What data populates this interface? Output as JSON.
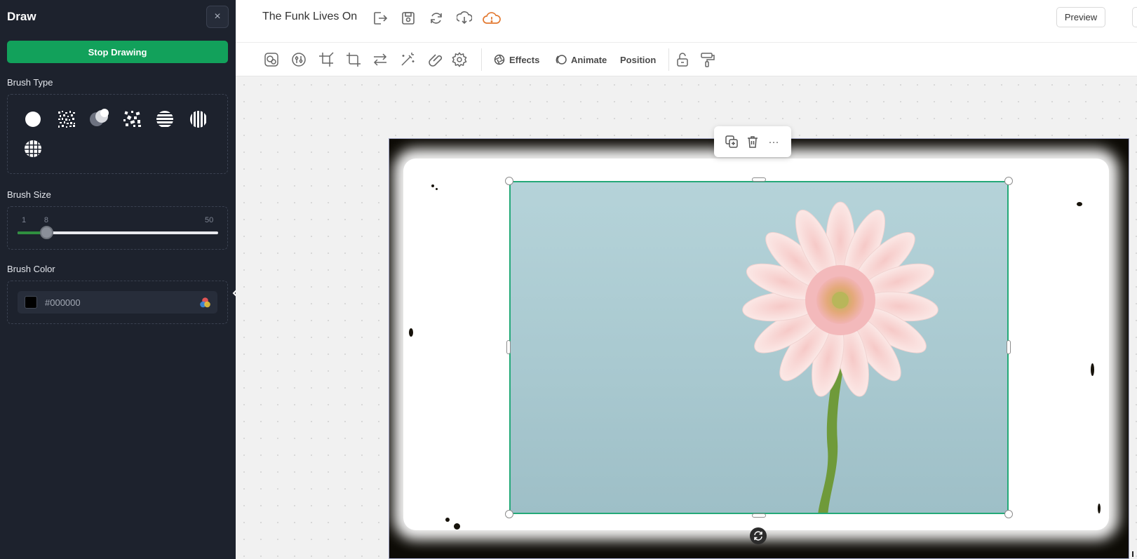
{
  "sidebar": {
    "title": "Draw",
    "close_glyph": "×",
    "stop_button": "Stop Drawing",
    "brush_type_label": "Brush Type",
    "brush_types": [
      "circle-brush-icon",
      "spray-brush-icon",
      "bubble-brush-icon",
      "splatter-brush-icon",
      "horizontal-lines-brush-icon",
      "vertical-lines-brush-icon",
      "grid-brush-icon"
    ],
    "brush_size_label": "Brush Size",
    "brush_size": {
      "min": "1",
      "value": "8",
      "max": "50",
      "value_num": 8,
      "min_num": 1,
      "max_num": 50
    },
    "brush_color_label": "Brush Color",
    "brush_color": "#000000",
    "collapse_glyph": "‹"
  },
  "header": {
    "title": "The Funk Lives On",
    "icons": [
      "export-icon",
      "save-icon",
      "sync-icon",
      "download-icon",
      "cloud-warning-icon"
    ],
    "preview_label": "Preview"
  },
  "toolbar": {
    "icons": [
      "mask-icon",
      "adjust-icon",
      "crop-icon",
      "resize-icon",
      "flip-icon",
      "magic-wand-icon",
      "link-icon",
      "settings-icon"
    ],
    "effects_label": "Effects",
    "animate_label": "Animate",
    "position_label": "Position",
    "right_icons": [
      "unlock-icon",
      "paint-roller-icon"
    ]
  },
  "floating_toolbar": {
    "icons": [
      "duplicate-icon",
      "trash-icon",
      "more-icon"
    ],
    "more_glyph": "···"
  },
  "colors": {
    "sidebar_bg": "#1d222d",
    "accent_green": "#12a15b",
    "selection_green": "#24a978",
    "cloud_orange": "#e2782f"
  }
}
